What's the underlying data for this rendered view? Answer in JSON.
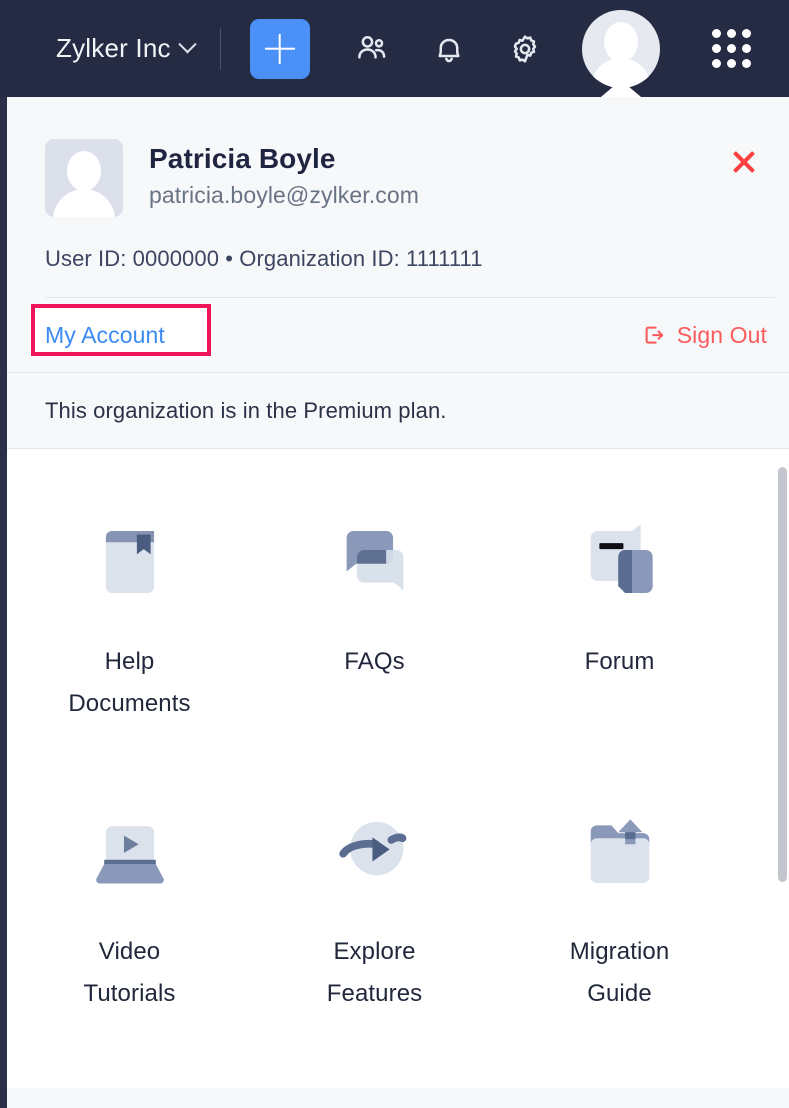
{
  "topbar": {
    "org_name": "Zylker Inc",
    "chevron_icon": "chevron-down-icon",
    "add_button_icon": "plus-icon",
    "icons": [
      {
        "name": "users-icon",
        "label": "Users"
      },
      {
        "name": "bell-icon",
        "label": "Notifications"
      },
      {
        "name": "gear-icon",
        "label": "Settings"
      }
    ],
    "avatar_icon": "user-avatar",
    "apps_grid_icon": "apps-grid-icon",
    "background_color": "#242b42",
    "accent_color": "#4a90f7"
  },
  "profile": {
    "name": "Patricia Boyle",
    "email": "patricia.boyle@zylker.com",
    "ids_line": "User ID: 0000000 • Organization ID: 1111111",
    "user_id": "0000000",
    "organization_id": "1111111",
    "avatar_icon": "user-avatar",
    "close_icon": "close-icon",
    "close_color": "#f94040"
  },
  "actions": {
    "my_account_label": "My Account",
    "my_account_color": "#3b8bf5",
    "highlight_color": "#f0145a",
    "sign_out_label": "Sign Out",
    "sign_out_icon": "sign-out-icon",
    "sign_out_color": "#fa5c5c"
  },
  "plan": {
    "message": "This organization is in the Premium plan."
  },
  "links": [
    {
      "label": "Help\nDocuments",
      "label_line1": "Help",
      "label_line2": "Documents",
      "icon": "book-icon"
    },
    {
      "label": "FAQs",
      "label_line1": "FAQs",
      "label_line2": "",
      "icon": "chat-bubbles-icon"
    },
    {
      "label": "Forum",
      "label_line1": "Forum",
      "label_line2": "",
      "icon": "forum-icon"
    },
    {
      "label": "Video\nTutorials",
      "label_line1": "Video",
      "label_line2": "Tutorials",
      "icon": "video-laptop-icon"
    },
    {
      "label": "Explore\nFeatures",
      "label_line1": "Explore",
      "label_line2": "Features",
      "icon": "orbit-arrow-icon"
    },
    {
      "label": "Migration\nGuide",
      "label_line1": "Migration",
      "label_line2": "Guide",
      "icon": "folder-upload-icon"
    }
  ],
  "scrollbar": {
    "name": "panel-scrollbar"
  }
}
